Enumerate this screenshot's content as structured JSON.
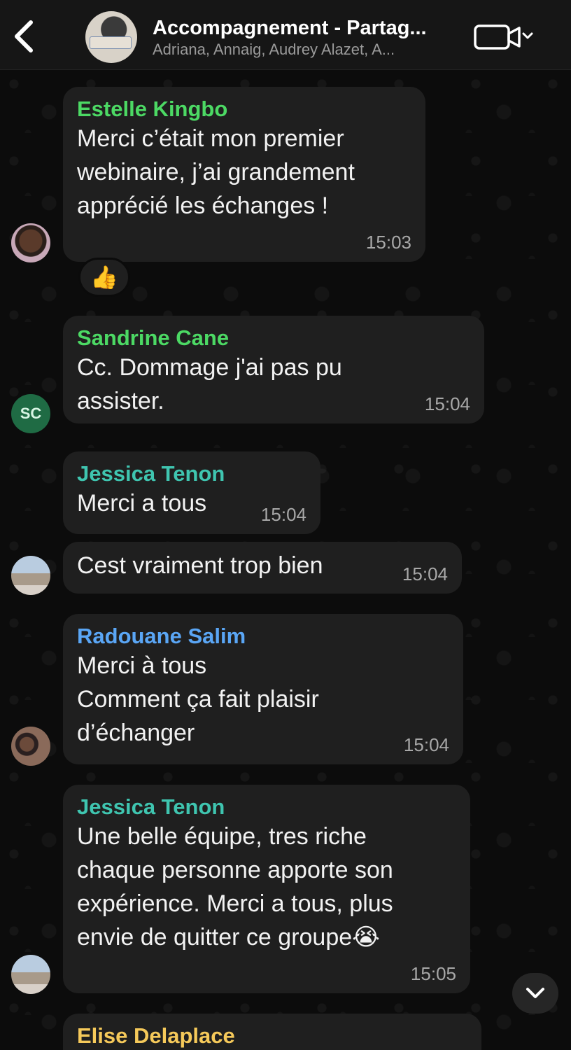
{
  "header": {
    "title": "Accompagnement - Partag...",
    "subtitle": "Adriana, Annaig, Audrey Alazet, A...",
    "back_icon": "chevron-left-icon",
    "video_icon": "video-call-icon"
  },
  "colors": {
    "sender_green": "#4cd964",
    "sender_teal": "#3fc5b0",
    "sender_blue": "#5aa6f5",
    "sender_yellow": "#f5c95a",
    "bubble": "#1f1f1f"
  },
  "messages": [
    {
      "sender": "Estelle Kingbo",
      "lines": [
        "Merci c’était mon premier",
        "webinaire, j’ai grandement",
        "apprécié les échanges !"
      ],
      "time": "15:03",
      "reaction": "👍",
      "avatar": "photo"
    },
    {
      "sender": "Sandrine Cane",
      "lines": [
        "Cc. Dommage j'ai pas pu",
        "assister."
      ],
      "time": "15:04",
      "avatar_initials": "SC"
    },
    {
      "sender": "Jessica Tenon",
      "lines": [
        "Merci a tous"
      ],
      "time": "15:04"
    },
    {
      "sender": "",
      "lines": [
        "Cest vraiment trop bien"
      ],
      "time": "15:04",
      "avatar": "photo"
    },
    {
      "sender": "Radouane Salim",
      "lines": [
        "Merci à tous",
        "Comment ça fait plaisir",
        "d’échanger"
      ],
      "time": "15:04",
      "avatar": "photo"
    },
    {
      "sender": "Jessica Tenon",
      "lines": [
        "Une belle équipe,  tres riche",
        "chaque personne apporte son",
        "expérience. Merci a tous, plus",
        "envie de quitter ce groupe😭"
      ],
      "time": "15:05",
      "avatar": "photo"
    },
    {
      "sender": "Elise Delaplace",
      "lines": [],
      "time": ""
    }
  ],
  "scroll_down_icon": "chevron-down-icon"
}
